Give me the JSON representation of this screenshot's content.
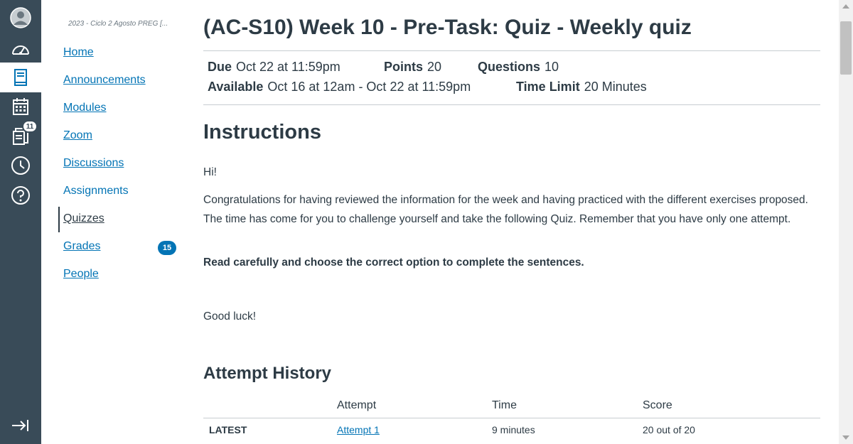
{
  "global_nav": {
    "inbox_badge": "11"
  },
  "course_nav": {
    "term": "2023 - Ciclo 2 Agosto PREG [...",
    "items": [
      {
        "label": "Home"
      },
      {
        "label": "Announcements"
      },
      {
        "label": "Modules"
      },
      {
        "label": "Zoom"
      },
      {
        "label": "Discussions"
      },
      {
        "label": "Assignments"
      },
      {
        "label": "Quizzes"
      },
      {
        "label": "Grades",
        "badge": "15"
      },
      {
        "label": "People"
      }
    ]
  },
  "quiz": {
    "title": "(AC-S10) Week 10 - Pre-Task: Quiz - Weekly quiz",
    "due_label": "Due",
    "due_value": "Oct 22 at 11:59pm",
    "points_label": "Points",
    "points_value": "20",
    "questions_label": "Questions",
    "questions_value": "10",
    "available_label": "Available",
    "available_value": "Oct 16 at 12am - Oct 22 at 11:59pm",
    "time_limit_label": "Time Limit",
    "time_limit_value": "20 Minutes"
  },
  "instructions": {
    "heading": "Instructions",
    "greeting": "Hi!",
    "body": "Congratulations for having reviewed the information for the week and having practiced with the different exercises proposed. The time has come for you to challenge yourself and take the following Quiz. Remember that you have only one attempt.",
    "bold_line": "Read carefully and choose the correct option to complete the sentences.",
    "closing": "Good luck!"
  },
  "attempt_history": {
    "heading": "Attempt History",
    "columns": [
      "Attempt",
      "Time",
      "Score"
    ],
    "rows": [
      {
        "tag": "LATEST",
        "attempt": "Attempt 1",
        "time": "9 minutes",
        "score": "20 out of 20"
      }
    ]
  },
  "colors": {
    "global_nav_bg": "#394b58",
    "link": "#0374b5",
    "text": "#2d3b45"
  }
}
